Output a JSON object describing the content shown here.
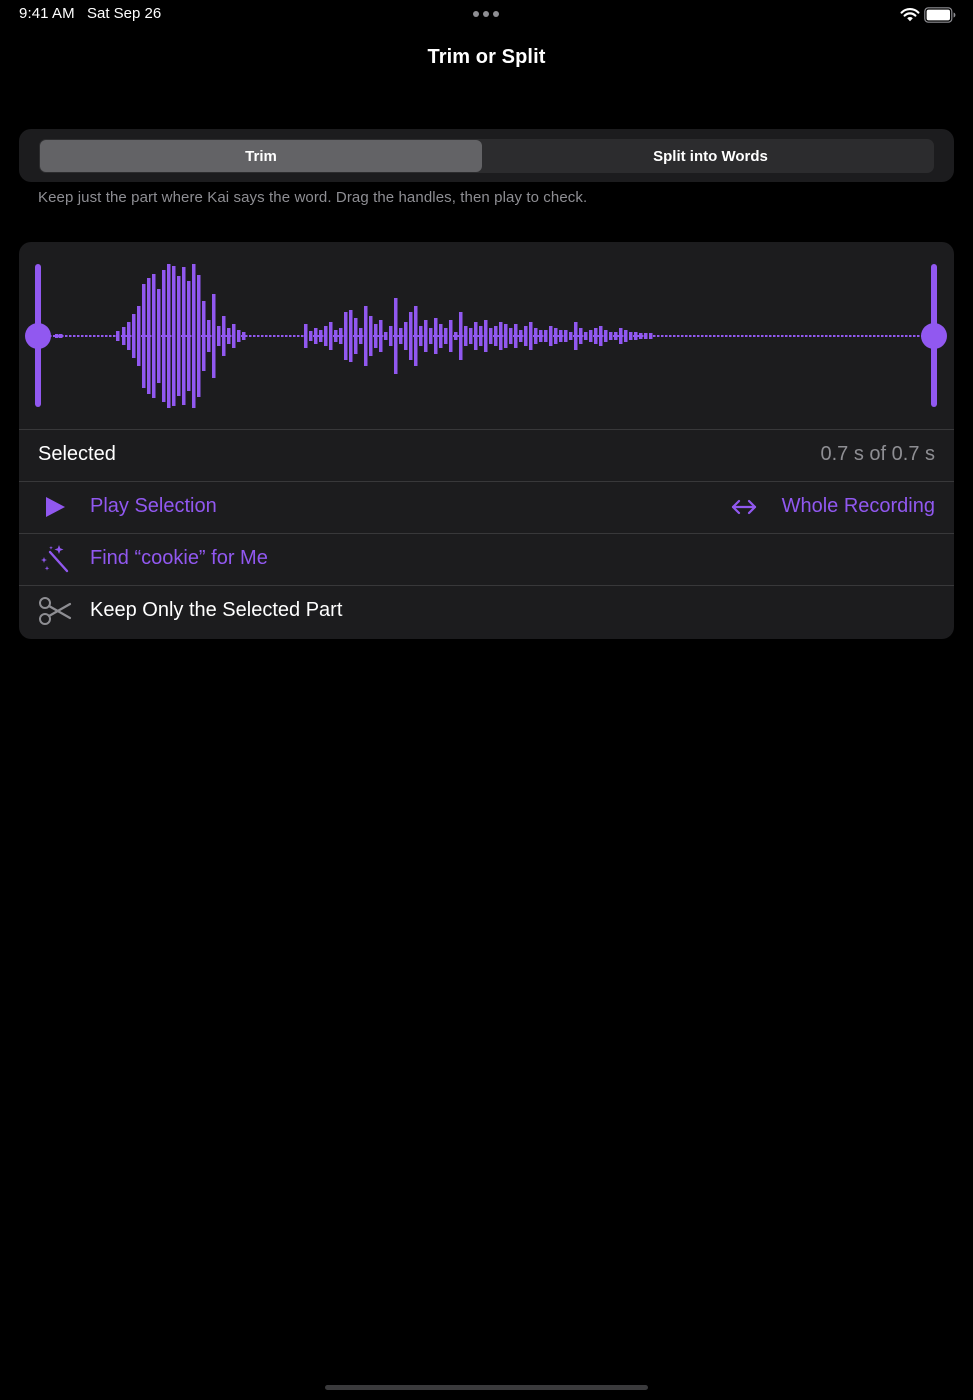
{
  "status_bar": {
    "time": "9:41 AM",
    "date": "Sat Sep 26"
  },
  "nav": {
    "title": "Trim or Split"
  },
  "segments": {
    "selected": "Trim",
    "items": [
      "Trim",
      "Split into Words"
    ]
  },
  "help_text": "Keep just the part where Kai says the word. Drag the handles, then play to check.",
  "selection": {
    "label": "Selected",
    "value": "0.7 s of 0.7 s"
  },
  "actions": {
    "play_label": "Play Selection",
    "whole_label": "Whole Recording",
    "find_label": "Find “cookie” for Me",
    "keep_label": "Keep Only the Selected Part"
  },
  "colors": {
    "accent": "#9158f0",
    "card": "#1c1c1e",
    "background": "#000000"
  },
  "icons": {
    "play": "play-icon",
    "whole": "arrow-left-right-icon",
    "find": "magic-wand-icon",
    "keep": "scissors-icon"
  }
}
